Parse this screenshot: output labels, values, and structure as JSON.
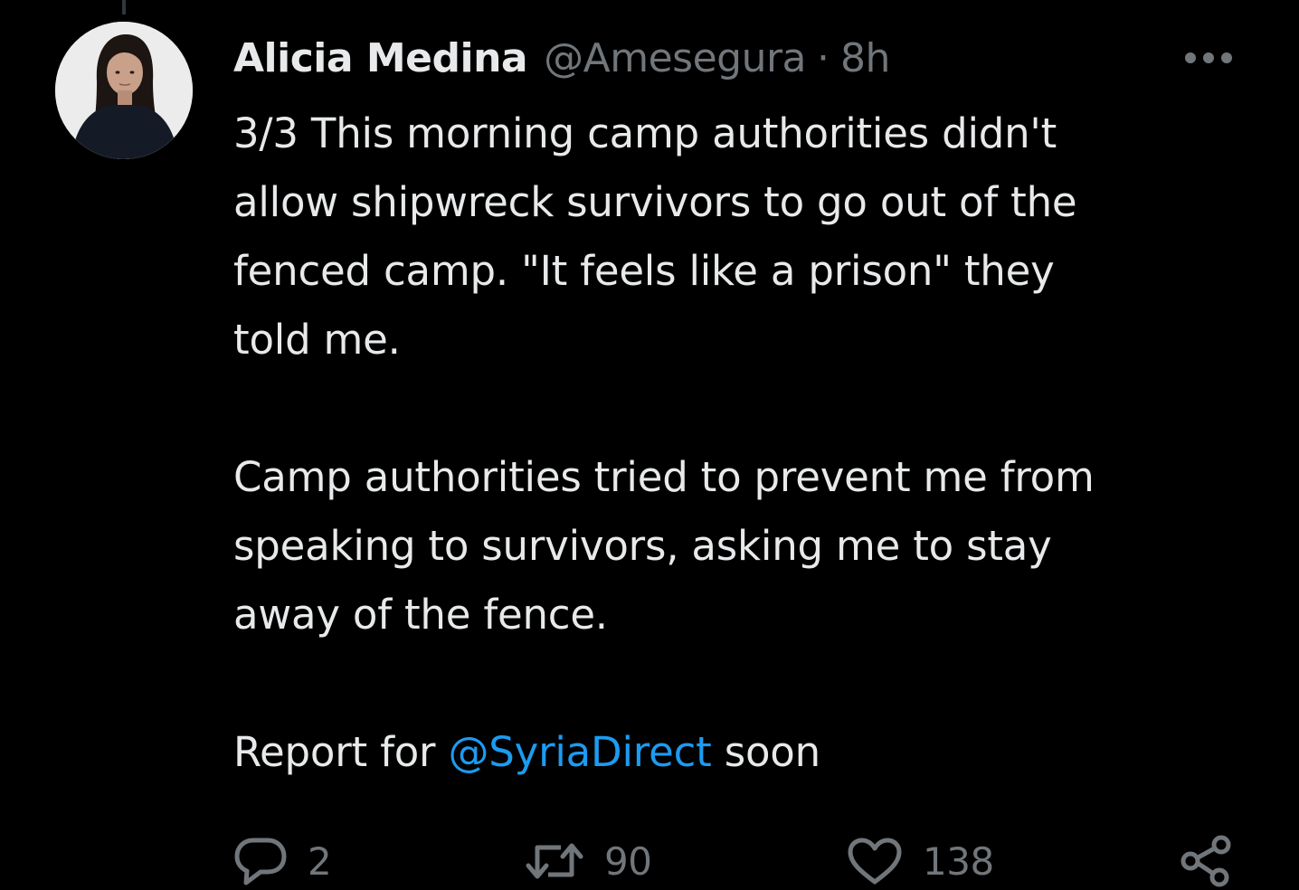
{
  "tweet": {
    "author": {
      "display_name": "Alicia Medina",
      "handle": "@Amesegura",
      "separator": "·",
      "time": "8h"
    },
    "body": {
      "paragraph_1": "3/3 This morning camp authorities didn't\nallow shipwreck survivors to go out of the\nfenced camp. \"It feels like a prison\" they\ntold me.",
      "paragraph_2": "Camp authorities tried to prevent me from\nspeaking to survivors, asking me to stay\naway of the fence.",
      "paragraph_3_prefix": "Report for ",
      "mention": "@SyriaDirect",
      "paragraph_3_suffix": " soon"
    },
    "actions": {
      "reply_count": "2",
      "retweet_count": "90",
      "like_count": "138"
    },
    "icons": {
      "more": "more-horizontal-icon",
      "reply": "reply-icon",
      "retweet": "retweet-icon",
      "like": "heart-icon",
      "share": "share-icon"
    }
  },
  "theme": {
    "background": "#000000",
    "text_primary": "#e7e9ea",
    "text_secondary": "#71767b",
    "link": "#1d9bf0"
  }
}
